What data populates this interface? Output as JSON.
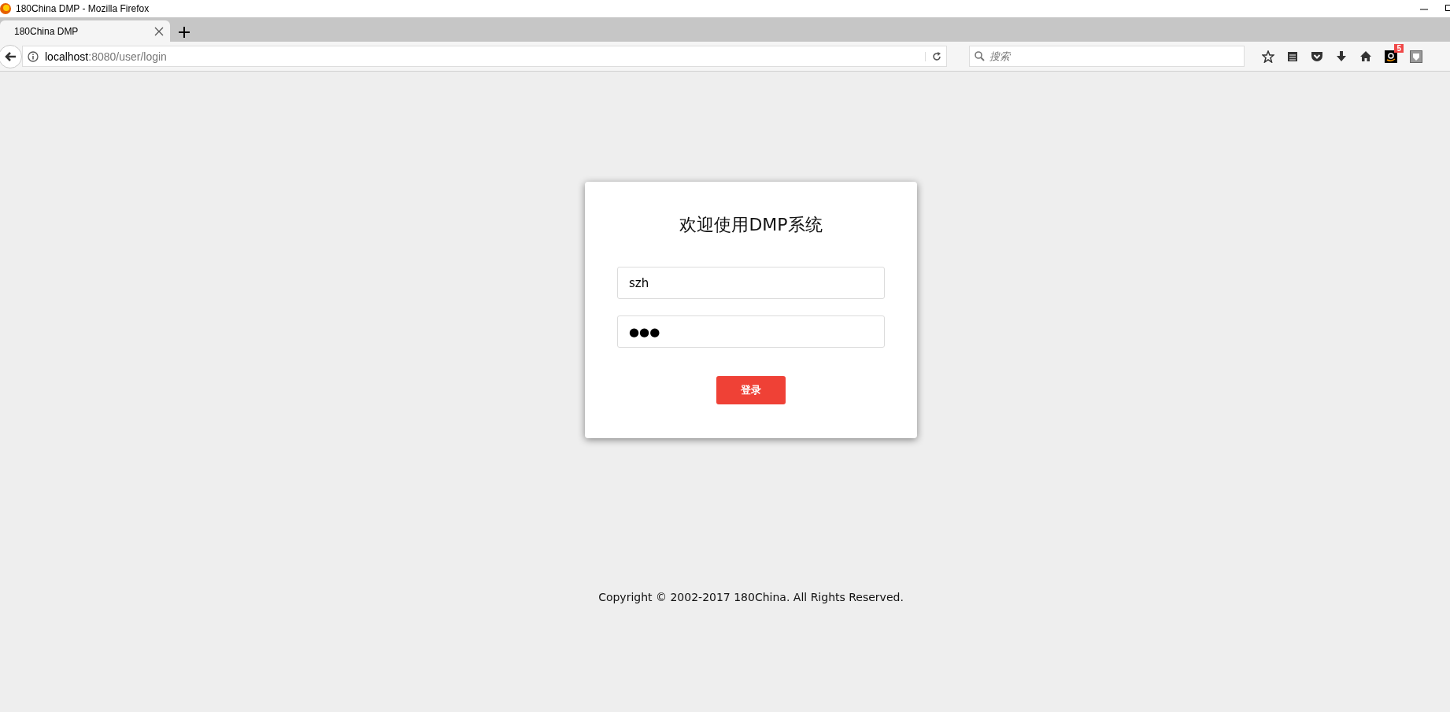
{
  "window": {
    "title": "180China DMP - Mozilla Firefox"
  },
  "tabs": [
    {
      "label": "180China DMP",
      "selected": true
    }
  ],
  "address_bar": {
    "host": "localhost",
    "path": ":8080/user/login"
  },
  "search": {
    "placeholder": "搜索"
  },
  "toolbar": {
    "badge": "5"
  },
  "login": {
    "title": "欢迎使用DMP系统",
    "username": "szh",
    "password": "●●●",
    "button": "登录"
  },
  "footer": "Copyright © 2002-2017 180China. All Rights Reserved."
}
